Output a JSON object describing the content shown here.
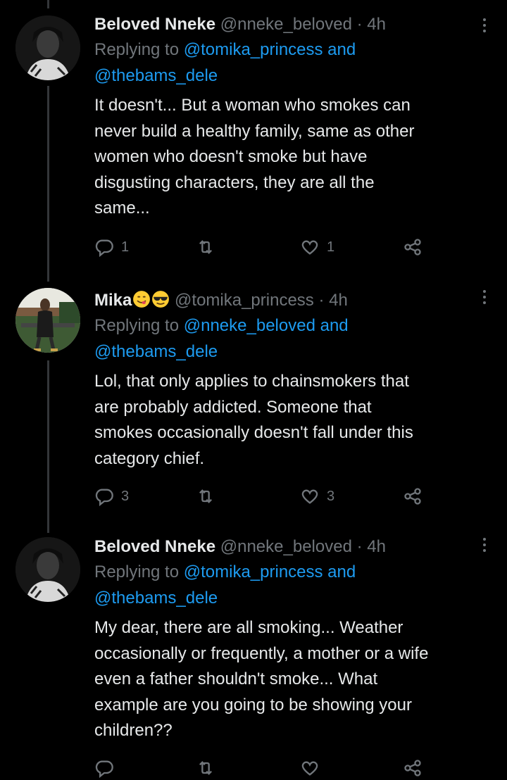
{
  "tweets": [
    {
      "name": "Beloved Nneke",
      "handle": "@nneke_beloved",
      "separator": "·",
      "time": "4h",
      "replying_label": "Replying to",
      "replying_links": "@tomika_princess and",
      "replying_link2": "@thebams_dele",
      "text_lines": [
        "It doesn't... But a woman who smokes can",
        "never build a healthy family, same as other",
        "women who doesn't smoke but have",
        "disgusting characters, they are all the",
        "same..."
      ],
      "reply_count": "1",
      "retweet_count": "",
      "like_count": "1"
    },
    {
      "name": "Mika",
      "handle": "@tomika_princess",
      "separator": "·",
      "time": "4h",
      "replying_label": "Replying to",
      "replying_links": "@nneke_beloved and",
      "replying_link2": "@thebams_dele",
      "text_lines": [
        "Lol, that only applies to chainsmokers that",
        "are probably addicted. Someone that",
        "smokes occasionally doesn't fall under this",
        "category chief."
      ],
      "reply_count": "3",
      "retweet_count": "",
      "like_count": "3"
    },
    {
      "name": "Beloved Nneke",
      "handle": "@nneke_beloved",
      "separator": "·",
      "time": "4h",
      "replying_label": "Replying to",
      "replying_links": "@tomika_princess and",
      "replying_link2": "@thebams_dele",
      "text_lines": [
        "My dear, there are all smoking... Weather",
        "occasionally or frequently, a mother or a wife",
        "even a father shouldn't smoke... What",
        "example are you going to be showing your",
        "children??"
      ]
    }
  ],
  "icons": {
    "reply": "reply-icon",
    "retweet": "retweet-icon",
    "like": "heart-icon",
    "share": "share-icon",
    "more": "more-icon"
  },
  "colors": {
    "background": "#000000",
    "text": "#e7e9ea",
    "muted": "#71767b",
    "link": "#1d9bf0"
  }
}
